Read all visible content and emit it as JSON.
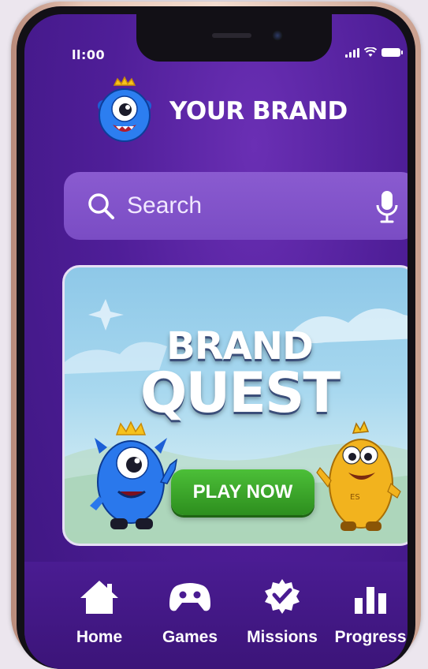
{
  "status_bar": {
    "time": "ll:00"
  },
  "brand": {
    "name": "YOUR BRAND"
  },
  "search": {
    "placeholder": "Search"
  },
  "banner": {
    "title_line1": "BRAND",
    "title_line2": "QUEST",
    "cta_label": "PLAY NOW",
    "yellow_character_badge": "ES"
  },
  "nav": {
    "items": [
      {
        "label": "Home",
        "icon": "home-icon"
      },
      {
        "label": "Games",
        "icon": "gamepad-icon"
      },
      {
        "label": "Missions",
        "icon": "mission-badge-icon"
      },
      {
        "label": "Progress",
        "icon": "bar-chart-icon"
      }
    ]
  },
  "colors": {
    "background": "#4f1e98",
    "search_bar": "#8a5bd0",
    "cta": "#3aa52a",
    "brand_text": "#ffffff"
  }
}
